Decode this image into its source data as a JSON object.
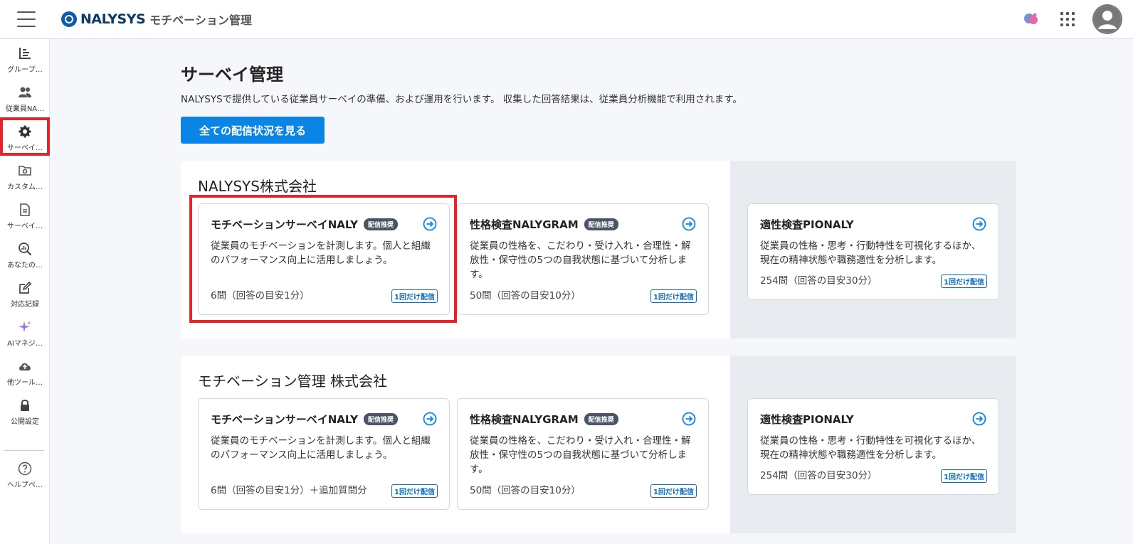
{
  "header": {
    "brand": "NALYSYS",
    "subtitle": "モチベーション管理"
  },
  "sidebar": {
    "items": [
      {
        "label": "グループ…",
        "icon": "chart-icon"
      },
      {
        "label": "従業員NA…",
        "icon": "people-icon"
      },
      {
        "label": "サーベイ…",
        "icon": "gear-icon"
      },
      {
        "label": "カスタム…",
        "icon": "folder-gear-icon"
      },
      {
        "label": "サーベイ…",
        "icon": "document-icon"
      },
      {
        "label": "あなたの…",
        "icon": "magnifier-chart-icon"
      },
      {
        "label": "対応記録",
        "icon": "edit-icon"
      },
      {
        "label": "AIマネジ…",
        "icon": "sparkle-icon"
      },
      {
        "label": "他ツール…",
        "icon": "cloud-upload-icon"
      },
      {
        "label": "公開設定",
        "icon": "lock-icon"
      },
      {
        "label": "ヘルプペ…",
        "icon": "help-icon"
      }
    ]
  },
  "main": {
    "title": "サーベイ管理",
    "description": "NALYSYSで提供している従業員サーベイの準備、および運用を行います。 収集した回答結果は、従業員分析機能で利用されます。",
    "view_all_button": "全ての配信状況を見る"
  },
  "companies": [
    {
      "name": "NALYSYS株式会社",
      "cards": [
        {
          "title": "モチベーションサーベイNALY",
          "badge": "配信推奨",
          "description": "従業員のモチベーションを計測します。個人と組織のパフォーマンス向上に活用しましょう。",
          "meta": "6問（回答の目安1分）",
          "tag": "1回だけ配信"
        },
        {
          "title": "性格検査NALYGRAM",
          "badge": "配信推奨",
          "description": "従業員の性格を、こだわり・受け入れ・合理性・解放性・保守性の5つの自我状態に基づいて分析します。",
          "meta": "50問（回答の目安10分）",
          "tag": "1回だけ配信"
        },
        {
          "title": "適性検査PIONALY",
          "badge": "",
          "description": "従業員の性格・思考・行動特性を可視化するほか、現在の精神状態や職務適性を分析します。",
          "meta": "254問（回答の目安30分）",
          "tag": "1回だけ配信"
        }
      ]
    },
    {
      "name": "モチベーション管理 株式会社",
      "cards": [
        {
          "title": "モチベーションサーベイNALY",
          "badge": "配信推奨",
          "description": "従業員のモチベーションを計測します。個人と組織のパフォーマンス向上に活用しましょう。",
          "meta": "6問（回答の目安1分）＋追加質問分",
          "tag": "1回だけ配信"
        },
        {
          "title": "性格検査NALYGRAM",
          "badge": "配信推奨",
          "description": "従業員の性格を、こだわり・受け入れ・合理性・解放性・保守性の5つの自我状態に基づいて分析します。",
          "meta": "50問（回答の目安10分）",
          "tag": "1回だけ配信"
        },
        {
          "title": "適性検査PIONALY",
          "badge": "",
          "description": "従業員の性格・思考・行動特性を可視化するほか、現在の精神状態や職務適性を分析します。",
          "meta": "254問（回答の目安30分）",
          "tag": "1回だけ配信"
        }
      ]
    }
  ],
  "colors": {
    "primary": "#0a85e6",
    "highlight": "#e3242b",
    "badge_bg": "#4a5568",
    "tag": "#0a6fc2"
  }
}
